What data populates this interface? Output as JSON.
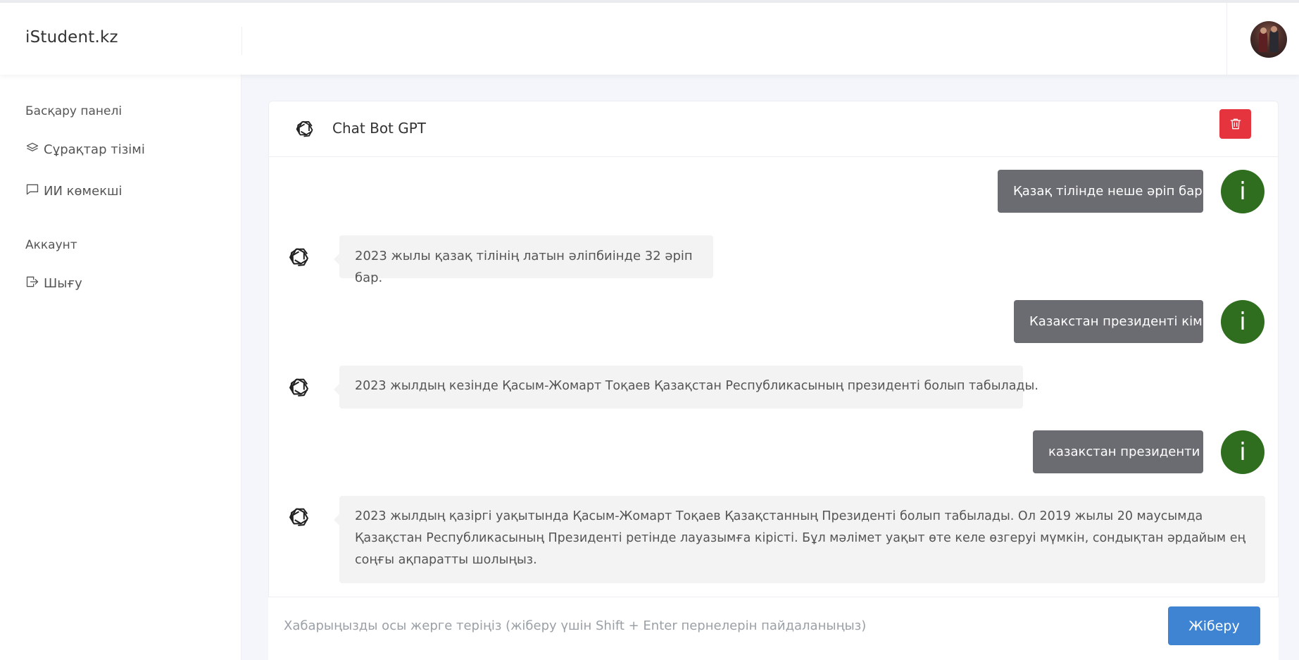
{
  "header": {
    "brand": "iStudent.kz"
  },
  "sidebar": {
    "sections": [
      {
        "heading": "Басқару панелі",
        "items": [
          {
            "label": "Сұрақтар тізімі",
            "icon": "layers-icon"
          },
          {
            "label": "ИИ көмекші",
            "icon": "chat-bubble-icon"
          }
        ]
      },
      {
        "heading": "Аккаунт",
        "items": [
          {
            "label": "Шығу",
            "icon": "logout-icon"
          }
        ]
      }
    ]
  },
  "chat": {
    "title": "Chat Bot GPT",
    "user_avatar_letter": "i",
    "messages": [
      {
        "role": "user",
        "text": "Қазақ тілінде неше әріп бар"
      },
      {
        "role": "bot",
        "text": "2023 жылы қазақ тілінің латын әліпбиінде 32 әріп бар."
      },
      {
        "role": "user",
        "text": "Казакстан президенті кім"
      },
      {
        "role": "bot",
        "text": "2023 жылдың кезінде Қасым-Жомарт Тоқаев Қазақстан Республикасының президенті болып табылады."
      },
      {
        "role": "user",
        "text": "казакстан президенти"
      },
      {
        "role": "bot",
        "text": "2023 жылдың қазіргі уақытында Қасым-Жомарт Тоқаев Қазақстанның Президенті болып табылады. Ол 2019 жылы 20 маусымда Қазақстан Республикасының Президенті ретінде лауазымға кірісті. Бұл мәлімет уақыт өте келе өзгеруі мүмкін, сондықтан әрдайым ең соңғы ақпаратты шолыңыз."
      }
    ],
    "input_placeholder": "Хабарыңызды осы жерге теріңіз (жіберу үшін Shift + Enter пернелерін пайдаланыңыз)",
    "input_value": "",
    "send_label": "Жіберу"
  },
  "colors": {
    "user_bubble": "#6a6c71",
    "bot_bubble": "#f3f3f3",
    "user_avatar": "#2f6e1e",
    "delete_button": "#e5343d",
    "send_button": "#3f83d3"
  }
}
